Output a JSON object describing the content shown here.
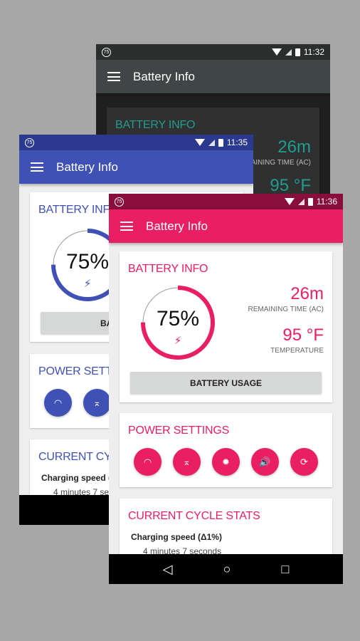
{
  "app_title": "Battery Info",
  "battery_level_percent": 75,
  "battery_percent_label": "75%",
  "status_badge": "75",
  "battery_info_title": "BATTERY INFO",
  "remaining_time": "26m",
  "remaining_label": "REMAINING TIME (AC)",
  "temperature": "95 °F",
  "temperature_label": "TEMPERATURE",
  "battery_usage_button": "BATTERY USAGE",
  "power_settings_title": "POWER SETTINGS",
  "power_buttons": [
    {
      "icon": "wifi-icon",
      "glyph": "◠"
    },
    {
      "icon": "wifi-hotspot-icon",
      "glyph": "⌅"
    },
    {
      "icon": "brightness-icon",
      "glyph": "✹"
    },
    {
      "icon": "volume-icon",
      "glyph": "🔊"
    },
    {
      "icon": "sync-icon",
      "glyph": "⟳"
    }
  ],
  "cycle_title": "CURRENT CYCLE STATS",
  "charging_speed_label": "Charging speed (Δ1%)",
  "charging_speed_value": "4 minutes 7 seconds",
  "nav": {
    "back": "◁",
    "home": "○",
    "recents": "□"
  },
  "phones": {
    "dark": {
      "time": "11:32",
      "accent": "#1f9d8f",
      "toolbar": "#404645",
      "status": "#2a2e2d"
    },
    "blue": {
      "time": "11:35",
      "accent": "#3f51b5",
      "toolbar": "#3f51b5",
      "status": "#2b3a8f"
    },
    "pink": {
      "time": "11:36",
      "accent": "#e91e63",
      "toolbar": "#e91e63",
      "status": "#880e3b"
    }
  }
}
